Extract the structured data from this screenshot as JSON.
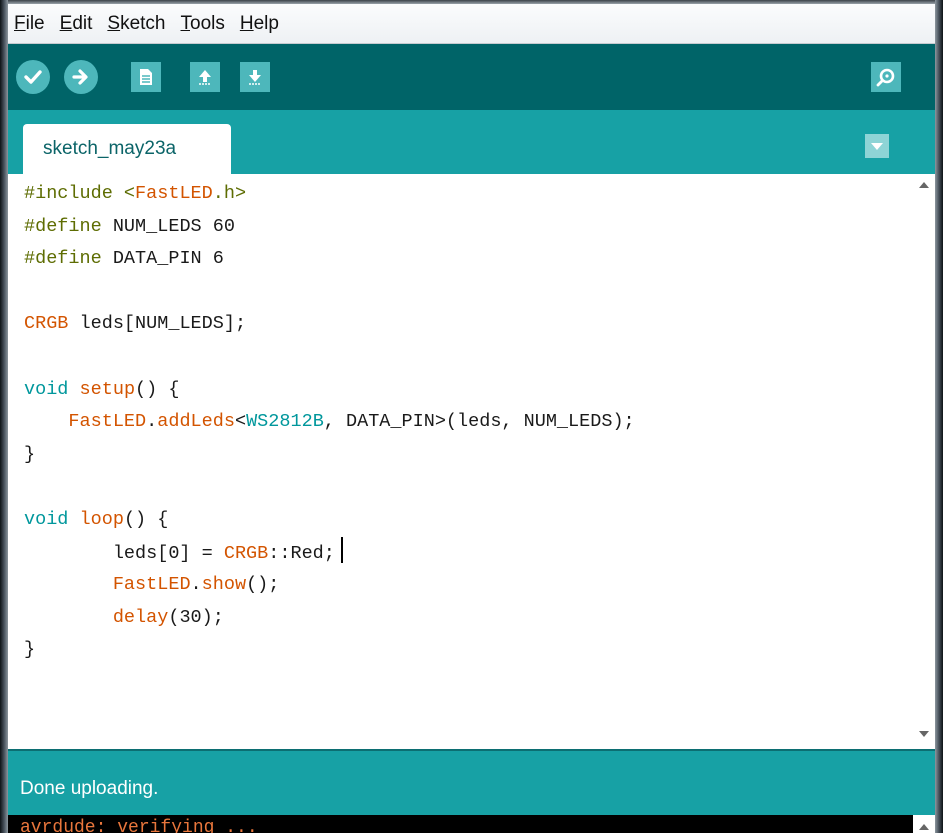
{
  "menubar": {
    "items": [
      {
        "label": "File",
        "mnemonic": "F",
        "rest": "ile"
      },
      {
        "label": "Edit",
        "mnemonic": "E",
        "rest": "dit"
      },
      {
        "label": "Sketch",
        "mnemonic": "S",
        "rest": "ketch"
      },
      {
        "label": "Tools",
        "mnemonic": "T",
        "rest": "ools"
      },
      {
        "label": "Help",
        "mnemonic": "H",
        "rest": "elp"
      }
    ]
  },
  "toolbar": {
    "buttons": [
      "verify-icon",
      "upload-icon",
      "new-icon",
      "open-icon",
      "save-icon",
      "serial-monitor-icon"
    ]
  },
  "tabs": {
    "active": "sketch_may23a"
  },
  "editor": {
    "lines": [
      [
        {
          "t": "#include <",
          "c": "kw-green"
        },
        {
          "t": "FastLED",
          "c": "kw-orange"
        },
        {
          "t": ".h>",
          "c": "kw-green"
        }
      ],
      [
        {
          "t": "#define ",
          "c": "kw-green"
        },
        {
          "t": "NUM_LEDS 60",
          "c": ""
        }
      ],
      [
        {
          "t": "#define ",
          "c": "kw-green"
        },
        {
          "t": "DATA_PIN 6",
          "c": ""
        }
      ],
      [],
      [
        {
          "t": "CRGB",
          "c": "kw-orange"
        },
        {
          "t": " leds[NUM_LEDS];",
          "c": ""
        }
      ],
      [],
      [
        {
          "t": "void",
          "c": "kw-blue"
        },
        {
          "t": " ",
          "c": ""
        },
        {
          "t": "setup",
          "c": "kw-orange"
        },
        {
          "t": "() {",
          "c": ""
        }
      ],
      [
        {
          "t": "    ",
          "c": ""
        },
        {
          "t": "FastLED",
          "c": "kw-orange"
        },
        {
          "t": ".",
          "c": ""
        },
        {
          "t": "addLeds",
          "c": "kw-orange"
        },
        {
          "t": "<",
          "c": ""
        },
        {
          "t": "WS2812B",
          "c": "kw-blue"
        },
        {
          "t": ", DATA_PIN>(leds, NUM_LEDS);",
          "c": ""
        }
      ],
      [
        {
          "t": "}",
          "c": ""
        }
      ],
      [],
      [
        {
          "t": "void",
          "c": "kw-blue"
        },
        {
          "t": " ",
          "c": ""
        },
        {
          "t": "loop",
          "c": "kw-orange"
        },
        {
          "t": "() {",
          "c": ""
        }
      ],
      [
        {
          "t": "        leds[0] = ",
          "c": ""
        },
        {
          "t": "CRGB",
          "c": "kw-orange"
        },
        {
          "t": "::Red;",
          "c": ""
        },
        {
          "cursor": true
        }
      ],
      [
        {
          "t": "        ",
          "c": ""
        },
        {
          "t": "FastLED",
          "c": "kw-orange"
        },
        {
          "t": ".",
          "c": ""
        },
        {
          "t": "show",
          "c": "kw-orange"
        },
        {
          "t": "();",
          "c": ""
        }
      ],
      [
        {
          "t": "        ",
          "c": ""
        },
        {
          "t": "delay",
          "c": "kw-orange"
        },
        {
          "t": "(30);",
          "c": ""
        }
      ],
      [
        {
          "t": "}",
          "c": ""
        }
      ]
    ]
  },
  "status": {
    "message": "Done uploading."
  },
  "console": {
    "text": "avrdude: verifying ..."
  }
}
